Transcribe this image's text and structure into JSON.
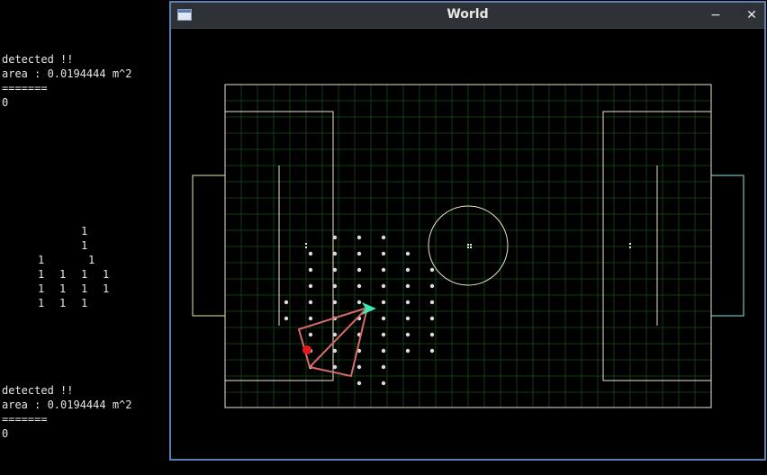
{
  "terminal": {
    "top_block": [
      "detected !!",
      "area : 0.0194444 m^2",
      "=======",
      "0"
    ],
    "bottom_block": [
      "detected !!",
      "area : 0.0194444 m^2",
      "=======",
      "0"
    ],
    "grid_rows": [
      [
        "1"
      ],
      [
        "1"
      ],
      [
        "1",
        "1"
      ],
      [
        "1",
        "1",
        "1",
        "1"
      ],
      [
        "1",
        "1",
        "1",
        "1"
      ],
      [
        "1",
        "1",
        "1"
      ]
    ]
  },
  "window": {
    "title": "World",
    "minimize_label": "−",
    "close_label": "✕",
    "field": {
      "line_color": "#e8e6c8",
      "grid_color": "#123d12",
      "left_goal_color": "#ece6a0",
      "right_goal_color": "#8ee8e0",
      "triangle_color": "#d86a6a",
      "robot_color": "#3ee8b0",
      "ball_color": "#e81818",
      "dot_color": "#dcdcdc"
    }
  }
}
